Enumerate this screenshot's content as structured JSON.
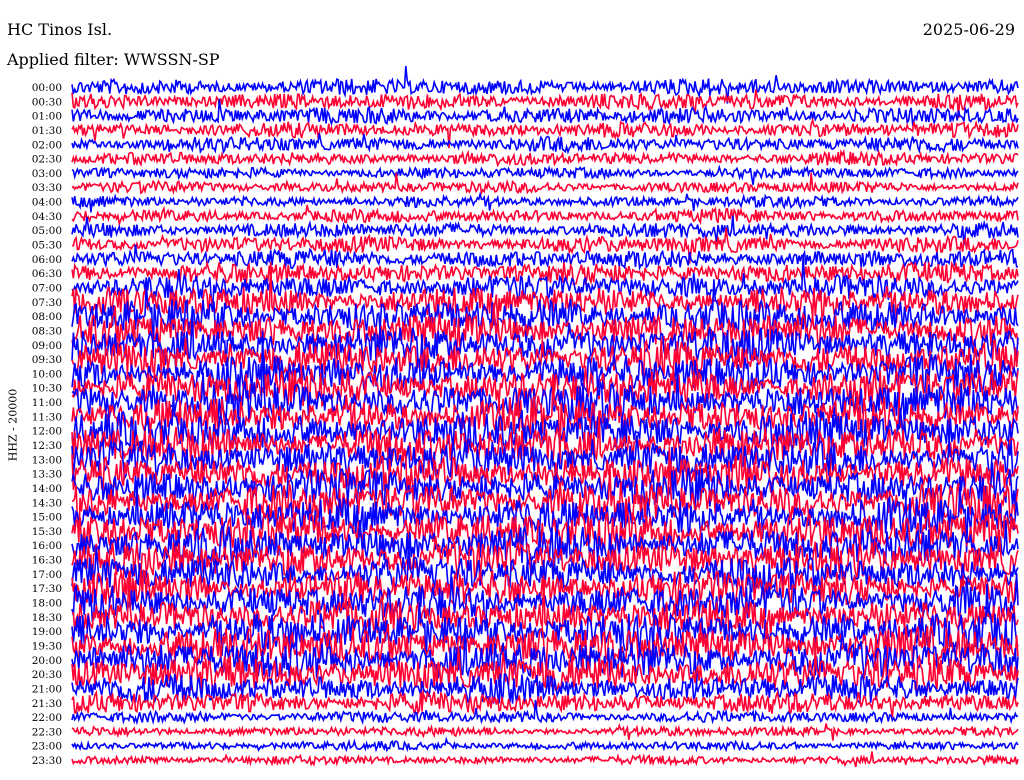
{
  "header": {
    "station": "HC Tinos Isl.",
    "date": "2025-06-29",
    "filter": "Applied filter: WWSSN-SP"
  },
  "chart_data": {
    "type": "helicorder",
    "channel_label": "HHZ - 20000",
    "row_labels": [
      "00:00",
      "00:30",
      "01:00",
      "01:30",
      "02:00",
      "02:30",
      "03:00",
      "03:30",
      "04:00",
      "04:30",
      "05:00",
      "05:30",
      "06:00",
      "06:30",
      "07:00",
      "07:30",
      "08:00",
      "08:30",
      "09:00",
      "09:30",
      "10:00",
      "10:30",
      "11:00",
      "11:30",
      "12:00",
      "12:30",
      "13:00",
      "13:30",
      "14:00",
      "14:30",
      "15:00",
      "15:30",
      "16:00",
      "16:30",
      "17:00",
      "17:30",
      "18:00",
      "18:30",
      "19:00",
      "19:30",
      "20:00",
      "20:30",
      "21:00",
      "21:30",
      "22:00",
      "22:30",
      "23:00",
      "23:30"
    ],
    "row_minutes": 30,
    "trace_colors": [
      "#0000ff",
      "#ff0033"
    ],
    "relative_amplitude": [
      0.9,
      0.9,
      0.9,
      0.8,
      0.8,
      0.7,
      0.6,
      0.6,
      0.6,
      0.7,
      0.8,
      0.9,
      1.0,
      1.1,
      1.3,
      1.6,
      1.8,
      1.8,
      1.9,
      1.9,
      2.0,
      2.0,
      2.0,
      2.0,
      2.0,
      2.0,
      2.0,
      2.0,
      2.0,
      2.0,
      2.0,
      2.0,
      2.0,
      2.0,
      1.9,
      1.9,
      1.9,
      1.9,
      2.0,
      2.0,
      2.0,
      1.9,
      1.5,
      1.1,
      0.6,
      0.5,
      0.45,
      0.45
    ]
  }
}
